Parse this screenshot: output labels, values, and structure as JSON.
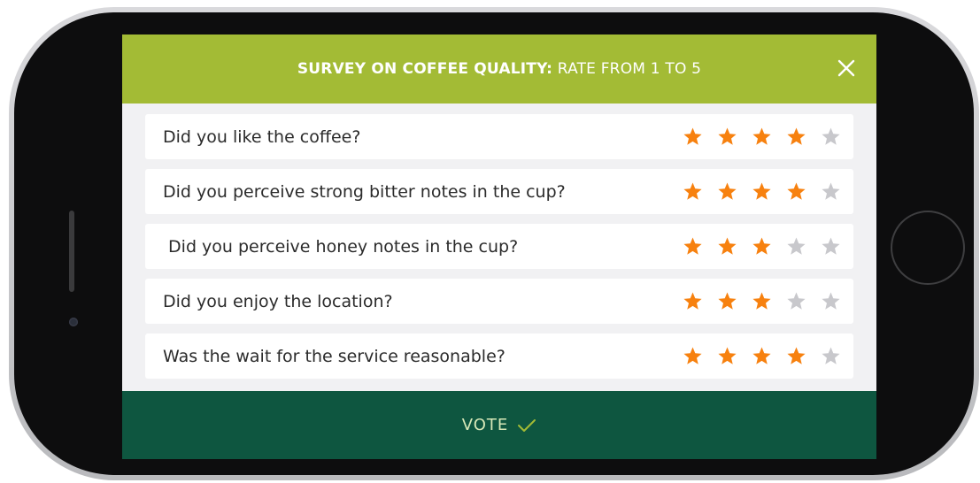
{
  "header": {
    "title_bold": "SURVEY ON COFFEE QUALITY:",
    "title_rest": " RATE FROM 1 TO 5",
    "close_icon": "close-icon"
  },
  "questions": [
    {
      "text": "Did you like the coffee?",
      "rating": 4
    },
    {
      "text": "Did you perceive strong bitter notes in the cup?",
      "rating": 4
    },
    {
      "text": " Did you perceive honey notes in the cup?",
      "rating": 3
    },
    {
      "text": "Did you enjoy the location?",
      "rating": 3
    },
    {
      "text": "Was the wait for the service reasonable?",
      "rating": 4
    }
  ],
  "rating_max": 5,
  "footer": {
    "vote_label": "VOTE",
    "icon": "checkmark-icon"
  },
  "colors": {
    "header": "#a3bb35",
    "footer": "#0e5640",
    "star_filled": "#f7810f",
    "star_empty": "#c8c8cc"
  }
}
